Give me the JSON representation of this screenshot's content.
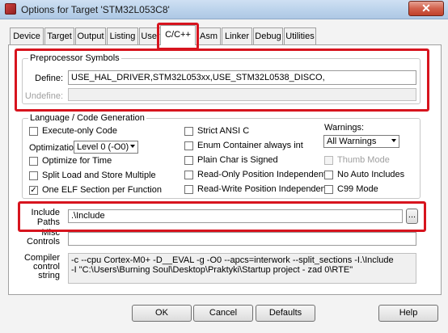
{
  "window": {
    "title": "Options for Target 'STM32L053C8'",
    "close_glyph": "✕",
    "app_icon": "keil-uvision-icon"
  },
  "tabs": [
    {
      "label": "Device",
      "active": false
    },
    {
      "label": "Target",
      "active": false
    },
    {
      "label": "Output",
      "active": false
    },
    {
      "label": "Listing",
      "active": false
    },
    {
      "label": "User",
      "active": false
    },
    {
      "label": "C/C++",
      "active": true
    },
    {
      "label": "Asm",
      "active": false
    },
    {
      "label": "Linker",
      "active": false
    },
    {
      "label": "Debug",
      "active": false
    },
    {
      "label": "Utilities",
      "active": false
    }
  ],
  "preprocessor": {
    "group_title": "Preprocessor Symbols",
    "define_label": "Define:",
    "define_value": "USE_HAL_DRIVER,STM32L053xx,USE_STM32L0538_DISCO,",
    "undefine_label": "Undefine:",
    "undefine_value": ""
  },
  "codegen": {
    "group_title": "Language / Code Generation",
    "execute_only": {
      "label": "Execute-only Code",
      "checked": false
    },
    "optimization_label": "Optimization:",
    "optimization_value": "Level 0 (-O0)",
    "optimize_time": {
      "label": "Optimize for Time",
      "checked": false
    },
    "split_load_store": {
      "label": "Split Load and Store Multiple",
      "checked": false
    },
    "one_elf": {
      "label": "One ELF Section per Function",
      "checked": true,
      "mark": "✓"
    },
    "strict_ansi": {
      "label": "Strict ANSI C",
      "checked": false
    },
    "enum_int": {
      "label": "Enum Container always int",
      "checked": false
    },
    "plain_char": {
      "label": "Plain Char is Signed",
      "checked": false
    },
    "ro_pi": {
      "label": "Read-Only Position Independent",
      "checked": false
    },
    "rw_pi": {
      "label": "Read-Write Position Independent",
      "checked": false
    },
    "warnings_label": "Warnings:",
    "warnings_value": "All Warnings",
    "thumb_mode": {
      "label": "Thumb Mode",
      "checked": false,
      "disabled": true
    },
    "no_auto_includes": {
      "label": "No Auto Includes",
      "checked": false
    },
    "c99_mode": {
      "label": "C99 Mode",
      "checked": false
    }
  },
  "include": {
    "label_line1": "Include",
    "label_line2": "Paths",
    "value": ".\\Include",
    "browse_label": "..."
  },
  "misc": {
    "label_line1": "Misc",
    "label_line2": "Controls",
    "value": ""
  },
  "compiler": {
    "label_line1": "Compiler",
    "label_line2": "control",
    "label_line3": "string",
    "line1": "-c --cpu Cortex-M0+ -D__EVAL -g -O0 --apcs=interwork --split_sections -I.\\Include",
    "line2": "-I \"C:\\Users\\Burning Soul\\Desktop\\Praktyki\\Startup project - zad 0\\RTE\""
  },
  "buttons": {
    "ok": "OK",
    "cancel": "Cancel",
    "defaults": "Defaults",
    "help": "Help"
  },
  "highlight_color": "#d7141e"
}
